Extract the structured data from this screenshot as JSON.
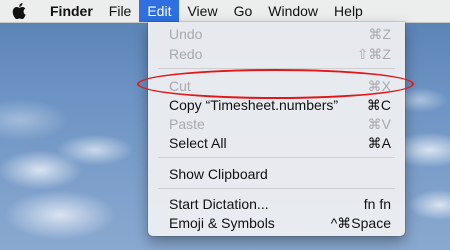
{
  "menubar": {
    "apple_icon": "apple-logo",
    "items": [
      {
        "label": "Finder",
        "bold": true
      },
      {
        "label": "File"
      },
      {
        "label": "Edit",
        "active": true
      },
      {
        "label": "View"
      },
      {
        "label": "Go"
      },
      {
        "label": "Window"
      },
      {
        "label": "Help"
      }
    ]
  },
  "edit_menu": {
    "items": [
      {
        "label": "Undo",
        "shortcut": "⌘Z",
        "enabled": false
      },
      {
        "label": "Redo",
        "shortcut": "⇧⌘Z",
        "enabled": false
      },
      {
        "label": "Cut",
        "shortcut": "⌘X",
        "enabled": false,
        "annotated": true
      },
      {
        "label": "Copy “Timesheet.numbers”",
        "shortcut": "⌘C",
        "enabled": true
      },
      {
        "label": "Paste",
        "shortcut": "⌘V",
        "enabled": false
      },
      {
        "label": "Select All",
        "shortcut": "⌘A",
        "enabled": true
      },
      {
        "label": "Show Clipboard",
        "shortcut": "",
        "enabled": true
      },
      {
        "label": "Start Dictation...",
        "shortcut": "fn fn",
        "enabled": true
      },
      {
        "label": "Emoji & Symbols",
        "shortcut": "^⌘Space",
        "enabled": true
      }
    ]
  },
  "colors": {
    "menubar_highlight": "#2f6fdf",
    "annotation_ellipse": "#e01818",
    "disabled_text": "#a9a9ad"
  }
}
